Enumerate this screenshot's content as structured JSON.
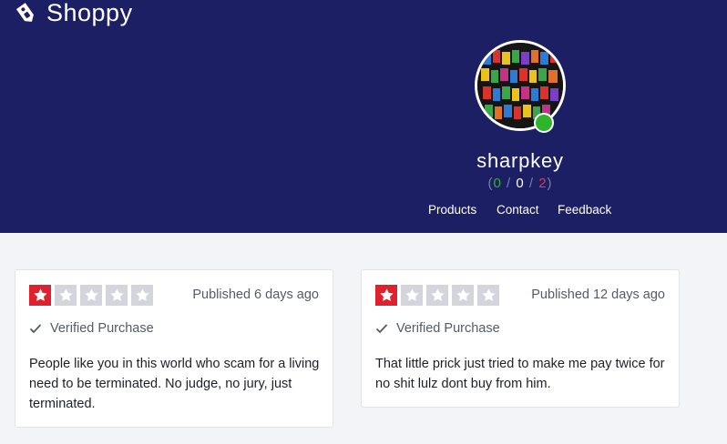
{
  "brand": {
    "name": "Shoppy"
  },
  "profile": {
    "username": "sharpkey",
    "online": true,
    "stats": {
      "open": "(",
      "positive": "0",
      "sep1": " / ",
      "neutral": "0",
      "sep2": " / ",
      "negative": "2",
      "close": ")"
    }
  },
  "nav": {
    "items": [
      "Products",
      "Contact",
      "Feedback"
    ]
  },
  "reviews": [
    {
      "rating": 1,
      "max_rating": 5,
      "published": "Published 6 days ago",
      "verified": "Verified Purchase",
      "text": "People like you in this world who scam for a living need to be terminated. No judge, no jury, just terminated."
    },
    {
      "rating": 1,
      "max_rating": 5,
      "published": "Published 12 days ago",
      "verified": "Verified Purchase",
      "text": "That little prick just tried to make me pay twice for no shit lulz dont buy from him."
    }
  ],
  "colors": {
    "header_bg": "#1c1f63",
    "star_active": "#e1202d",
    "star_inactive": "#d4d5dc",
    "positive": "#2fb52a",
    "negative": "#e23a4f",
    "online": "#2fb52a"
  }
}
